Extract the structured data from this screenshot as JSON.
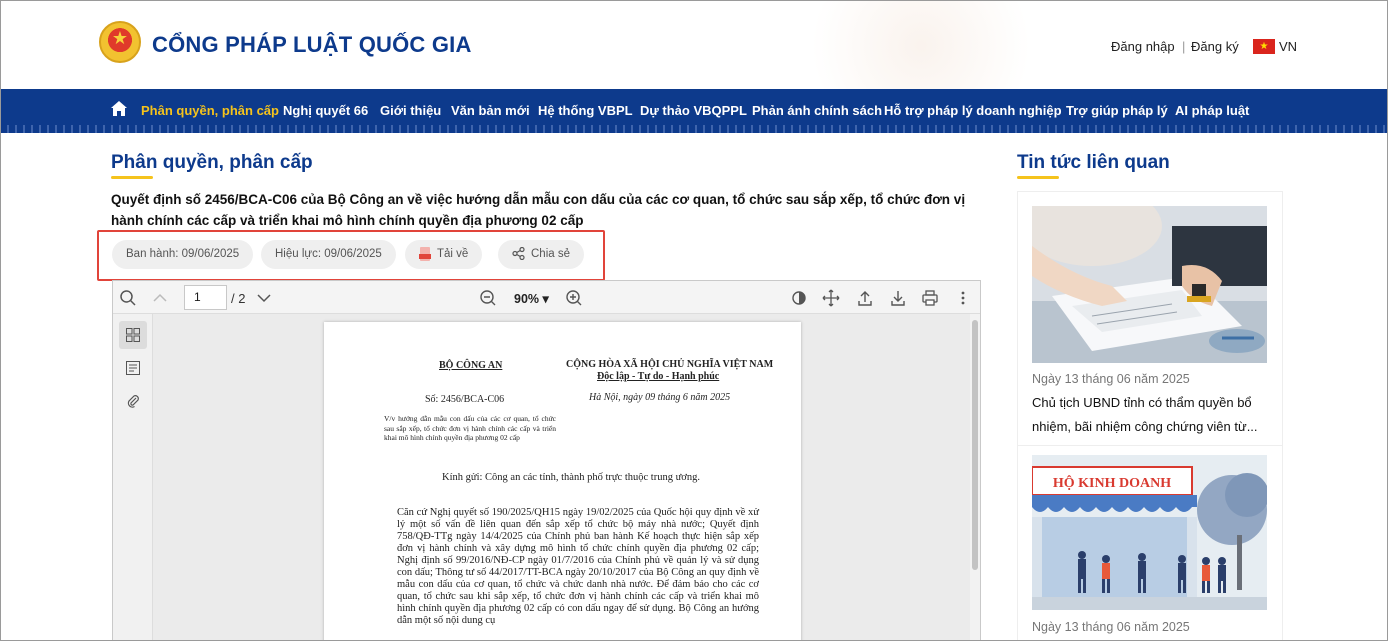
{
  "header": {
    "site_title": "CỔNG PHÁP LUẬT QUỐC GIA",
    "login": "Đăng nhập",
    "separator": "|",
    "register": "Đăng ký",
    "lang": "VN"
  },
  "nav": {
    "items": [
      {
        "label": "Phân quyền, phân cấp",
        "active": true
      },
      {
        "label": "Nghị quyết 66"
      },
      {
        "label": "Giới thiệu"
      },
      {
        "label": "Văn bản mới"
      },
      {
        "label": "Hệ thống VBPL"
      },
      {
        "label": "Dự thảo VBQPPL"
      },
      {
        "label": "Phản ánh chính sách"
      },
      {
        "label": "Hỗ trợ pháp lý doanh nghiệp"
      },
      {
        "label": "Trợ giúp pháp lý"
      },
      {
        "label": "AI pháp luật"
      }
    ]
  },
  "main": {
    "section_title": "Phân quyền, phân cấp",
    "doc_title": "Quyết định số 2456/BCA-C06 của Bộ Công an về việc hướng dẫn mẫu con dấu của các cơ quan, tổ chức sau sắp xếp, tổ chức đơn vị hành chính các cấp và triển khai mô hình chính quyền địa phương 02 cấp",
    "meta": {
      "issued": "Ban hành: 09/06/2025",
      "effective": "Hiệu lực: 09/06/2025",
      "download": "Tải về",
      "share": "Chia sẻ"
    }
  },
  "viewer": {
    "page_current": "1",
    "page_total": "/ 2",
    "zoom": "90% ▾",
    "doc": {
      "org": "BỘ CÔNG AN",
      "nation": "CỘNG HÒA XÃ HỘI CHỦ NGHĨA VIỆT NAM",
      "motto": "Độc lập - Tự do - Hạnh phúc",
      "number": "Số: 2456/BCA-C06",
      "place_date": "Hà Nội, ngày 09 tháng 6 năm 2025",
      "subject": "V/v hướng dẫn mẫu con dấu của các cơ quan, tổ chức sau sắp xếp, tổ chức đơn vị hành chính các cấp và triển khai mô hình chính quyền địa phương 02 cấp",
      "recipient": "Kính gửi: Công an các tỉnh, thành phố trực thuộc trung ương.",
      "body": "Căn cứ Nghị quyết số 190/2025/QH15 ngày 19/02/2025 của Quốc hội quy định về xử lý một số vấn đề liên quan đến sắp xếp tổ chức bộ máy nhà nước; Quyết định 758/QĐ-TTg ngày 14/4/2025 của Chính phủ ban hành Kế hoạch thực hiện sắp xếp đơn vị hành chính và xây dựng mô hình tổ chức chính quyền địa phương 02 cấp; Nghị định số 99/2016/NĐ-CP ngày 01/7/2016 của Chính phủ về quản lý và sử dụng con dấu; Thông tư số 44/2017/TT-BCA ngày 20/10/2017 của Bộ Công an quy định về mẫu con dấu của cơ quan, tổ chức và chức danh nhà nước. Để đảm bảo cho các cơ quan, tổ chức sau khi sắp xếp, tổ chức đơn vị hành chính các cấp và triển khai mô hình chính quyền địa phương 02 cấp có con dấu ngay để sử dụng. Bộ Công an hướng dẫn một số nội dung cụ"
    }
  },
  "sidebar": {
    "title": "Tin tức liên quan",
    "news": [
      {
        "date": "Ngày 13 tháng 06 năm 2025",
        "title": "Chủ tịch UBND tỉnh có thẩm quyền bổ nhiệm, bãi nhiệm công chứng viên từ..."
      },
      {
        "date": "Ngày 13 tháng 06 năm 2025",
        "image_text": "HỘ KINH DOANH"
      }
    ]
  },
  "colors": {
    "brand_blue": "#0d3a8c",
    "accent_yellow": "#f5c31c",
    "highlight_red": "#e1443a"
  }
}
